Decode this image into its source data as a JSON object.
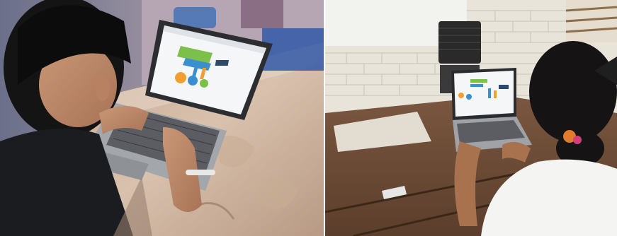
{
  "photos": [
    {
      "name": "left-photo",
      "subject": "student-using-laptop-at-glass-table"
    },
    {
      "name": "right-photo",
      "subject": "student-using-laptop-at-wooden-desk"
    }
  ],
  "colors": {
    "background": "#ffffff",
    "screen_bg": "#f4f6f8",
    "infographic_green": "#7cc04b",
    "infographic_blue": "#3a8fd0",
    "infographic_orange": "#f0a030",
    "desk_wood": "#6b4a34",
    "brick_wall": "#e8e4da"
  }
}
